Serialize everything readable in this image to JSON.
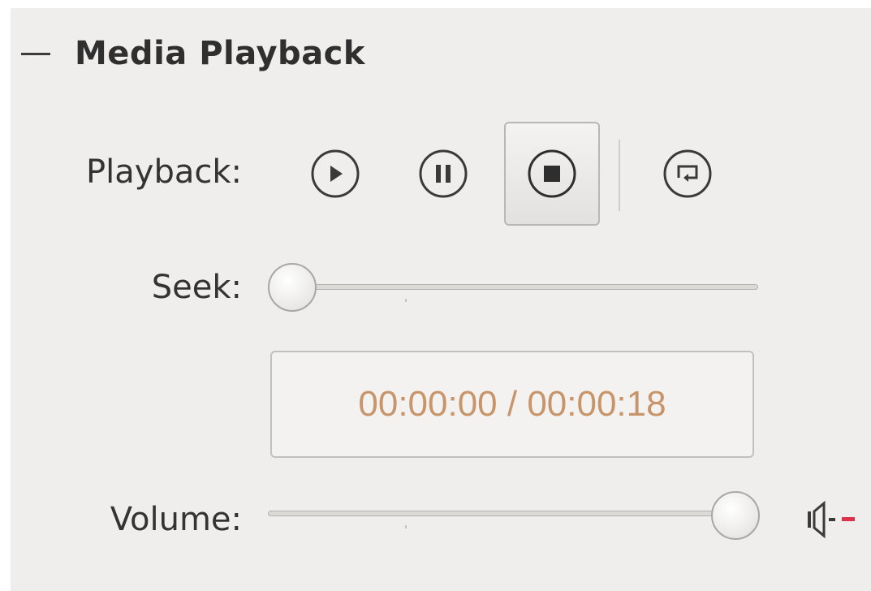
{
  "section": {
    "title": "Media Playback",
    "collapse_icon": "minus-icon"
  },
  "playback": {
    "label": "Playback:",
    "buttons": [
      {
        "name": "play",
        "icon": "play-icon"
      },
      {
        "name": "pause",
        "icon": "pause-icon"
      },
      {
        "name": "stop",
        "icon": "stop-icon",
        "active": true
      },
      {
        "name": "loop",
        "icon": "loop-icon"
      }
    ]
  },
  "seek": {
    "label": "Seek:",
    "position_fraction": 0.0
  },
  "time_display": {
    "text": "00:00:00 / 00:00:18"
  },
  "volume": {
    "label": "Volume:",
    "level_fraction": 1.0,
    "icon": "speaker-muted-icon"
  },
  "colors": {
    "panel_bg": "#efeeec",
    "time_text": "#c8956a",
    "mute_indicator": "#d9324a"
  }
}
